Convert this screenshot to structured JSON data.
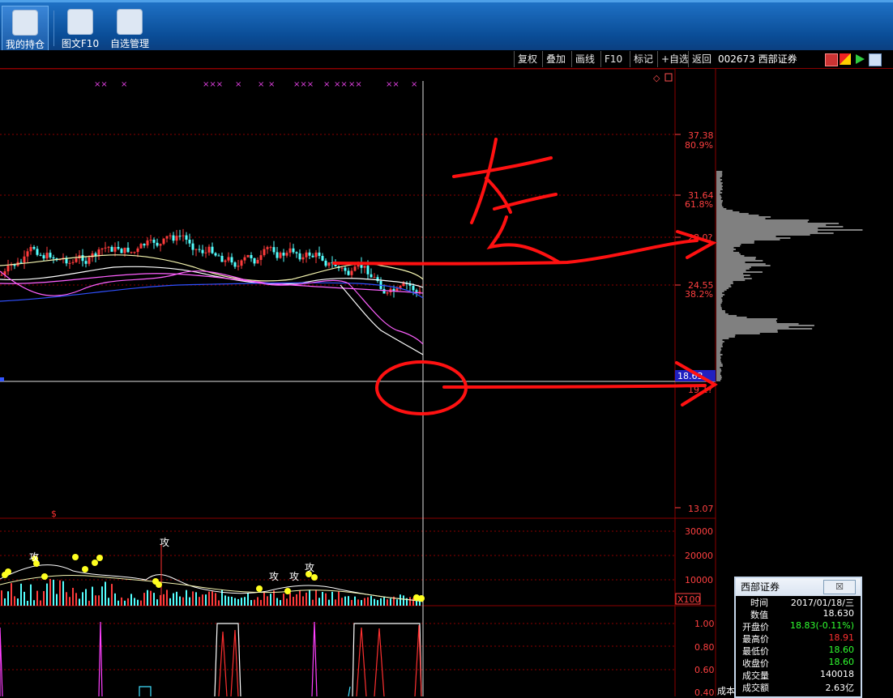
{
  "toolbar": {
    "buttons": [
      {
        "label": "我的持仓",
        "icon": "portfolio-icon"
      },
      {
        "label": "图文F10",
        "icon": "chart-info-icon"
      },
      {
        "label": "自选管理",
        "icon": "watchlist-icon"
      }
    ]
  },
  "chart_toolbar": {
    "buttons": [
      "复权",
      "叠加",
      "画线",
      "F10",
      "标记",
      "+自选",
      "返回"
    ],
    "stock_code": "002673",
    "stock_name": "西部证券"
  },
  "price_axis": {
    "labels": [
      {
        "price": "37.38",
        "pct": "80.9%"
      },
      {
        "price": "31.64",
        "pct": "61.8%"
      },
      {
        "price": "28.0?",
        "pct": ""
      },
      {
        "price": "24.55",
        "pct": "38.2%"
      },
      {
        "price": "19.1?",
        "pct": ""
      },
      {
        "price": "13.07",
        "pct": ""
      }
    ],
    "current_price_tag": "18.63"
  },
  "volume_axis": {
    "labels": [
      "30000",
      "20000",
      "10000"
    ],
    "unit": "X100",
    "markers": [
      "攻",
      "攻",
      "攻",
      "攻",
      "攻"
    ]
  },
  "indicator_axis": {
    "labels": [
      "1.00",
      "0.80",
      "0.60",
      "0.40"
    ],
    "cost_label": "成本"
  },
  "annotation": {
    "handwriting": "套"
  },
  "info_popup": {
    "title": "西部证券",
    "close": "☒",
    "rows": [
      {
        "key": "时间",
        "value": "2017/01/18/三"
      },
      {
        "key": "数值",
        "value": "18.630"
      },
      {
        "key": "开盘价",
        "value": "18.83(-0.11%)"
      },
      {
        "key": "最高价",
        "value": "18.91"
      },
      {
        "key": "最低价",
        "value": "18.60"
      },
      {
        "key": "收盘价",
        "value": "18.60"
      },
      {
        "key": "成交量",
        "value": "140018"
      },
      {
        "key": "成交额",
        "value": "2.63亿"
      }
    ]
  },
  "colors": {
    "up": "#ff3b3b",
    "down": "#54ffff",
    "annotation": "#ff1111",
    "grid": "#8b0000",
    "label": "#ff4040"
  }
}
